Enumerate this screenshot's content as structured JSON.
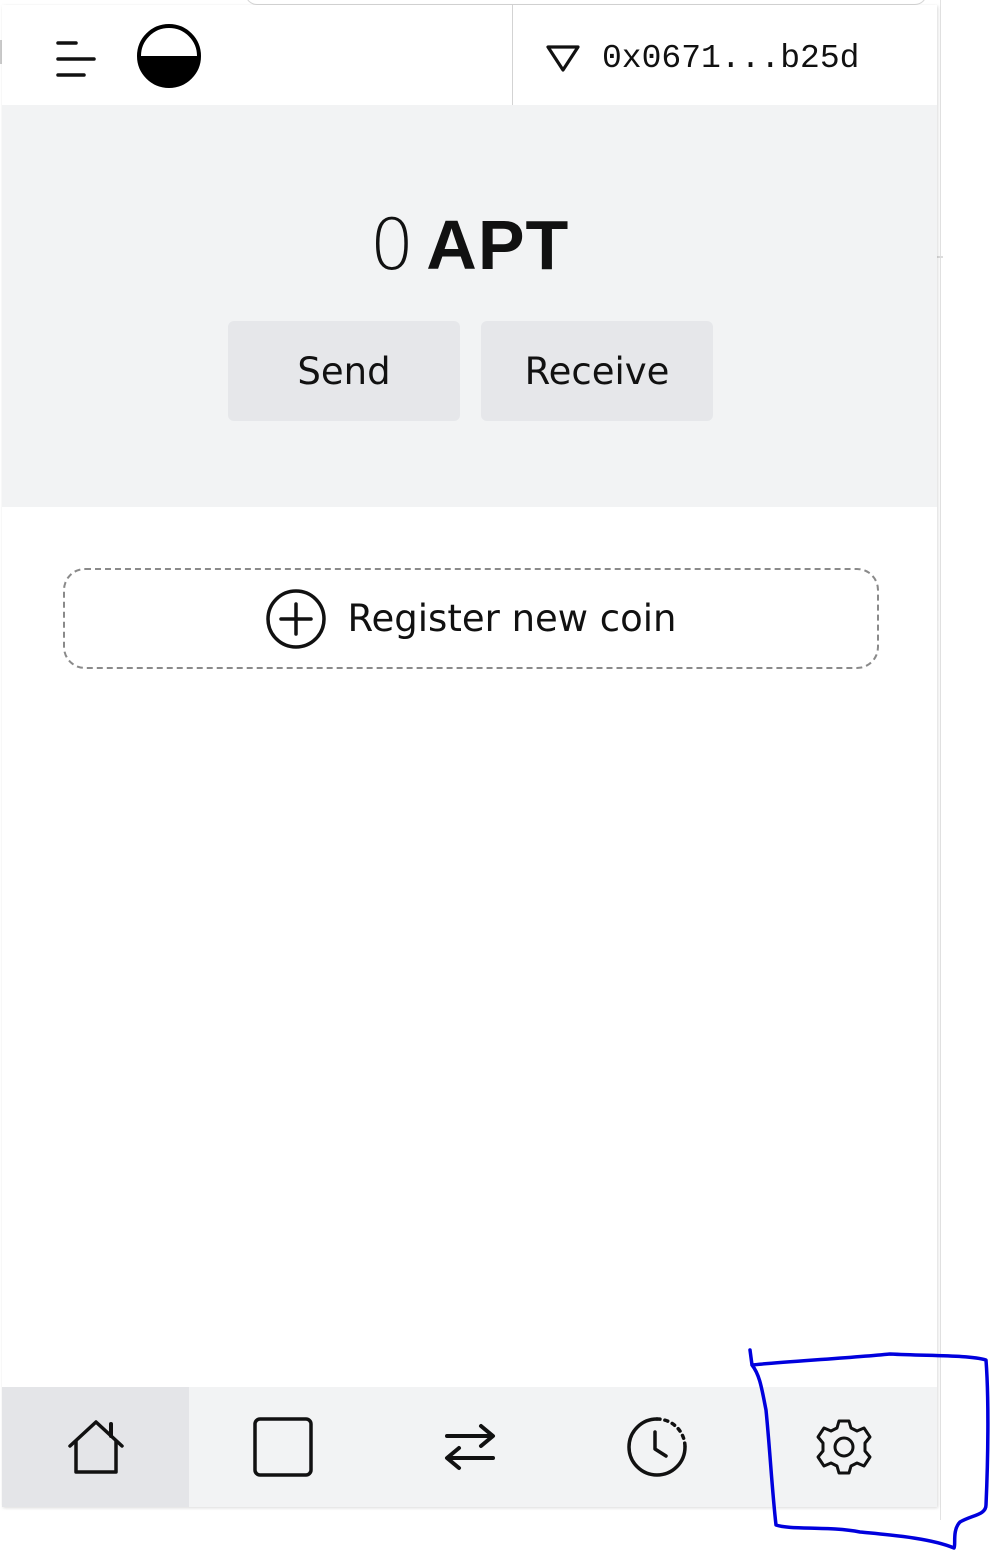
{
  "header": {
    "menu_icon": "menu-icon",
    "logo_icon": "half-circle-logo",
    "network_icon": "triangle-down-icon",
    "address": "0x0671...b25d"
  },
  "balance": {
    "amount": "0",
    "symbol": "APT"
  },
  "actions": {
    "send_label": "Send",
    "receive_label": "Receive"
  },
  "register": {
    "icon": "plus-circle-icon",
    "label": "Register new coin"
  },
  "bottom_nav": {
    "items": [
      {
        "icon": "home-icon",
        "active": true
      },
      {
        "icon": "square-icon",
        "active": false
      },
      {
        "icon": "swap-arrows-icon",
        "active": false
      },
      {
        "icon": "clock-icon",
        "active": false
      },
      {
        "icon": "gear-icon",
        "active": false
      }
    ]
  },
  "colors": {
    "panel_background": "#f2f3f4",
    "button_background": "#e6e7ea",
    "active_tab": "#e4e5e8",
    "annotation_ink": "#0000dd"
  }
}
